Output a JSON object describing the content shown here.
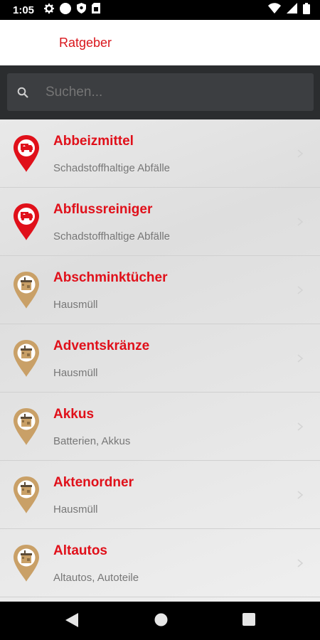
{
  "status_bar": {
    "time": "1:05",
    "left_icons": [
      "gear-icon",
      "circle-icon",
      "shield-icon",
      "sim-icon"
    ],
    "right_icons": [
      "wifi-icon",
      "signal-icon",
      "battery-icon"
    ]
  },
  "app_bar": {
    "title": "Ratgeber"
  },
  "search": {
    "placeholder": "Suchen..."
  },
  "list": {
    "items": [
      {
        "name": "Abbeizmittel",
        "category": "Schadstoffhaltige Abfälle",
        "icon": "hazardous-truck-pin-icon"
      },
      {
        "name": "Abflussreiniger",
        "category": "Schadstoffhaltige Abfälle",
        "icon": "hazardous-truck-pin-icon"
      },
      {
        "name": "Abschminktücher",
        "category": "Hausmüll",
        "icon": "waste-bin-pin-icon"
      },
      {
        "name": "Adventskränze",
        "category": "Hausmüll",
        "icon": "waste-bin-pin-icon"
      },
      {
        "name": "Akkus",
        "category": "Batterien, Akkus",
        "icon": "waste-bin-pin-icon"
      },
      {
        "name": "Aktenordner",
        "category": "Hausmüll",
        "icon": "waste-bin-pin-icon"
      },
      {
        "name": "Altautos",
        "category": "Altautos, Autoteile",
        "icon": "waste-bin-pin-icon"
      }
    ]
  },
  "nav_bar": {
    "buttons": [
      "back-icon",
      "home-icon",
      "recents-icon"
    ]
  },
  "colors": {
    "accent": "#e0101a",
    "hazard_pin": "#e0101a",
    "bin_pin": "#c9a067",
    "search_bg": "#2b2d2f"
  }
}
